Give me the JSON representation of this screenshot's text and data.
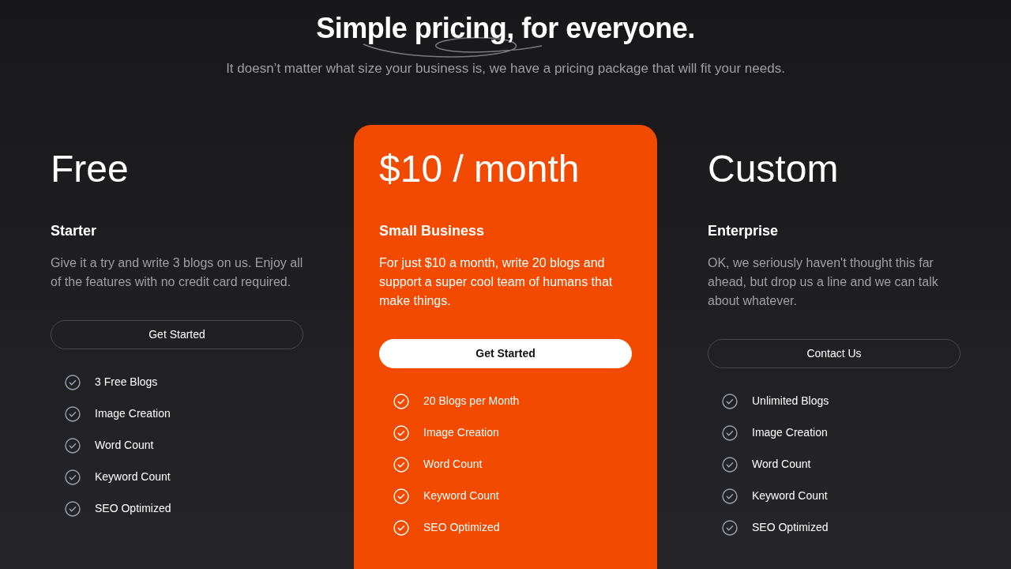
{
  "header": {
    "title": "Simple pricing, for everyone.",
    "subtitle": "It doesn’t matter what size your business is, we have a pricing package that will fit your needs."
  },
  "plans": [
    {
      "price": "Free",
      "name": "Starter",
      "description": "Give it a try and write 3 blogs on us. Enjoy all of the features with no credit card required.",
      "button": "Get Started",
      "featured": false,
      "features": [
        "3 Free Blogs",
        "Image Creation",
        "Word Count",
        "Keyword Count",
        "SEO Optimized"
      ]
    },
    {
      "price": "$10 / month",
      "name": "Small Business",
      "description": "For just $10 a month, write 20 blogs and support a super cool team of humans that make things.",
      "button": "Get Started",
      "featured": true,
      "features": [
        "20 Blogs per Month",
        "Image Creation",
        "Word Count",
        "Keyword Count",
        "SEO Optimized"
      ]
    },
    {
      "price": "Custom",
      "name": "Enterprise",
      "description": "OK, we seriously haven't thought this far ahead, but drop us a line and we can talk about whatever.",
      "button": "Contact Us",
      "featured": false,
      "features": [
        "Unlimited Blogs",
        "Image Creation",
        "Word Count",
        "Keyword Count",
        "SEO Optimized"
      ]
    }
  ]
}
